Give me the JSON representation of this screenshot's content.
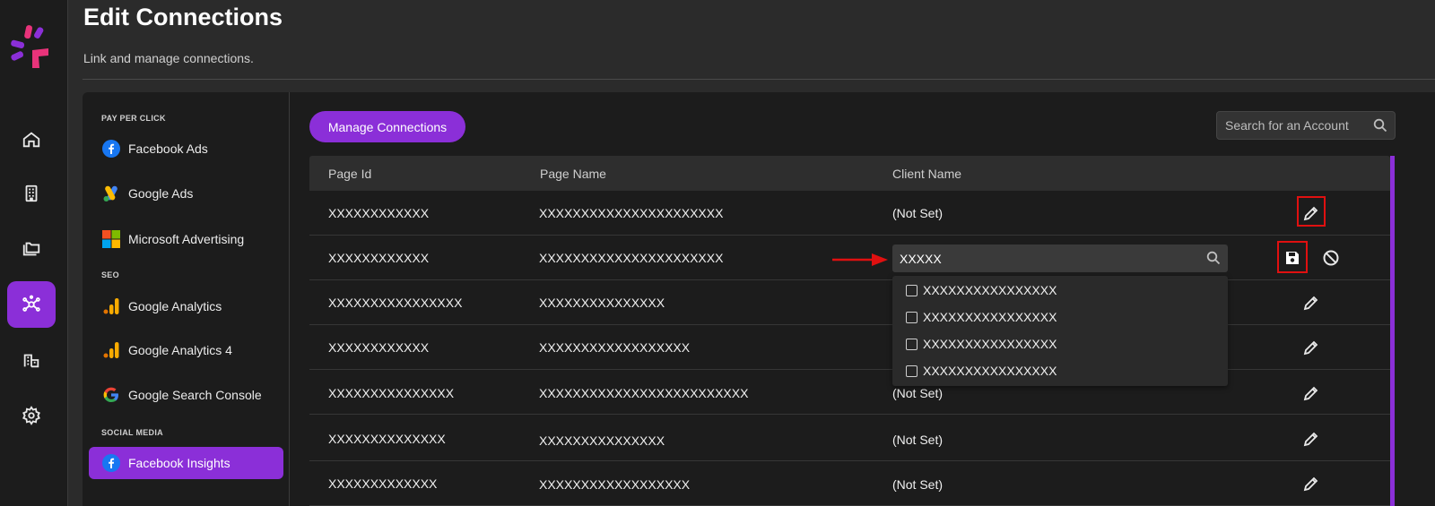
{
  "header": {
    "title": "Edit Connections",
    "subtitle": "Link and manage connections."
  },
  "rail": {
    "items": [
      {
        "icon": "home-icon"
      },
      {
        "icon": "building-icon"
      },
      {
        "icon": "folders-icon"
      },
      {
        "icon": "connections-icon",
        "active": true
      },
      {
        "icon": "reports-icon"
      },
      {
        "icon": "gear-icon"
      }
    ]
  },
  "sidenav": {
    "sections": [
      {
        "label": "PAY PER CLICK"
      },
      {
        "label": "SEO"
      },
      {
        "label": "SOCIAL MEDIA"
      }
    ],
    "items": [
      {
        "label": "Facebook Ads",
        "icon": "facebook-icon"
      },
      {
        "label": "Google Ads",
        "icon": "google-ads-icon"
      },
      {
        "label": "Microsoft Advertising",
        "icon": "microsoft-icon"
      },
      {
        "label": "Google Analytics",
        "icon": "google-analytics-icon"
      },
      {
        "label": "Google Analytics 4",
        "icon": "google-analytics-icon"
      },
      {
        "label": "Google Search Console",
        "icon": "google-icon"
      },
      {
        "label": "Facebook Insights",
        "icon": "facebook-icon",
        "active": true
      }
    ]
  },
  "toolbar": {
    "manage_label": "Manage Connections",
    "search_placeholder": "Search for an Account"
  },
  "table": {
    "columns": [
      "Page Id",
      "Page Name",
      "Client Name"
    ],
    "rows": [
      {
        "page_id": "XXXXXXXXXXXX",
        "page_name": "XXXXXXXXXXXXXXXXXXXXXX",
        "client_name": "(Not Set)"
      },
      {
        "page_id": "XXXXXXXXXXXX",
        "page_name": "XXXXXXXXXXXXXXXXXXXXXX",
        "client_name": ""
      },
      {
        "page_id": "XXXXXXXXXXXXXXXX",
        "page_name": "XXXXXXXXXXXXXXX",
        "client_name": ""
      },
      {
        "page_id": "XXXXXXXXXXXX",
        "page_name": "XXXXXXXXXXXXXXXXXX",
        "client_name": ""
      },
      {
        "page_id": "XXXXXXXXXXXXXXX",
        "page_name": "XXXXXXXXXXXXXXXXXXXXXXXXX",
        "client_name": "(Not Set)"
      },
      {
        "page_id": "XXXXXXXXXXXXXX",
        "page_name": "XXXXXXXXXXXXXXX",
        "client_name": "(Not Set)"
      },
      {
        "page_id": "XXXXXXXXXXXXX",
        "page_name": "XXXXXXXXXXXXXXXXXX",
        "client_name": "(Not Set)"
      }
    ]
  },
  "edit_row": {
    "input_value": "XXXXX",
    "options": [
      "XXXXXXXXXXXXXXXX",
      "XXXXXXXXXXXXXXXX",
      "XXXXXXXXXXXXXXXX",
      "XXXXXXXXXXXXXXXX"
    ]
  },
  "colors": {
    "accent": "#8b2fd8",
    "highlight": "#e01010"
  }
}
